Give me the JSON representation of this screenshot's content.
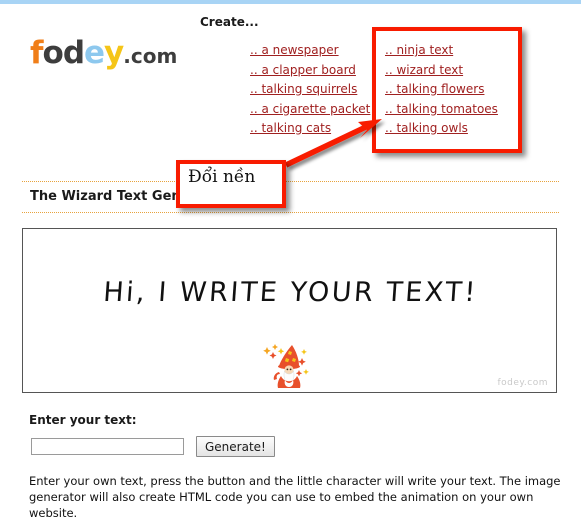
{
  "site": {
    "logo_parts": [
      {
        "char": "f",
        "color": "#f07e18"
      },
      {
        "char": "o",
        "color": "#3d3d3d"
      },
      {
        "char": "d",
        "color": "#3d3d3d"
      },
      {
        "char": "e",
        "color": "#8dc8ee"
      },
      {
        "char": "y",
        "color": "#f5c518"
      },
      {
        "char": ".com",
        "color": "#3d3d3d"
      }
    ],
    "logo_text": "fodey.com",
    "accent_link_color": "#a02020",
    "rule_color": "#e8a33d",
    "top_strip_color": "#a8d4f5"
  },
  "nav": {
    "heading": "Create...",
    "column_1": [
      ".. a newspaper",
      ".. a clapper board",
      ".. talking squirrels",
      ".. a cigarette packet",
      ".. talking cats"
    ],
    "column_2": [
      ".. ninja text",
      ".. wizard text",
      ".. talking flowers",
      ".. talking tomatoes",
      ".. talking owls"
    ]
  },
  "page": {
    "title": "The Wizard Text Gene"
  },
  "preview": {
    "handwritten_text": "Hi, I WRITE YOUR  TEXT!",
    "watermark": "fodey.com",
    "character_icon": "wizard-icon"
  },
  "form": {
    "label": "Enter your text:",
    "input_value": "",
    "input_placeholder": "",
    "button_label": "Generate!"
  },
  "description": {
    "text": "Enter your own text, press the button and the little character will write your text. The image generator will also create HTML code you can use to embed the animation on your own website."
  },
  "annotations": {
    "note_text": "Đổi nền",
    "highlight_color": "#f81b00"
  }
}
